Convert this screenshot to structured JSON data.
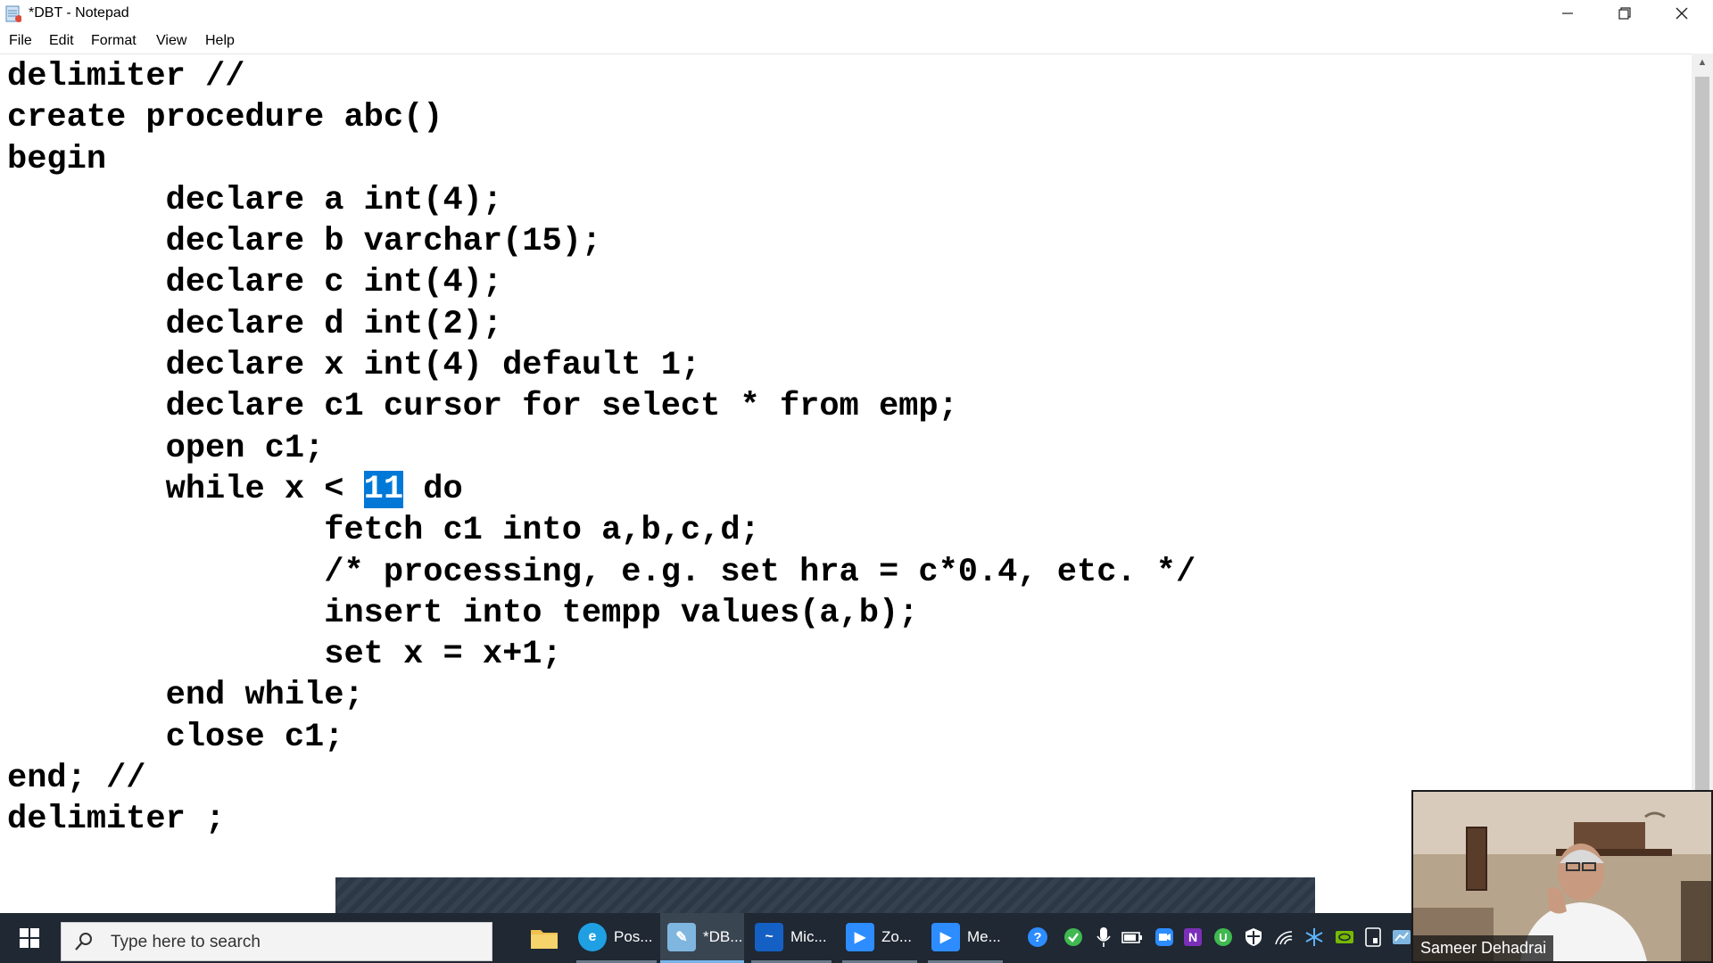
{
  "window": {
    "title": "*DBT - Notepad"
  },
  "menu": [
    "File",
    "Edit",
    "Format",
    "View",
    "Help"
  ],
  "editor": {
    "lines": [
      "delimiter //",
      "create procedure abc()",
      "begin",
      "        declare a int(4);",
      "        declare b varchar(15);",
      "        declare c int(4);",
      "        declare d int(2);",
      "        declare x int(4) default 1;",
      "        declare c1 cursor for select * from emp;",
      "        open c1;",
      "        while x < ",
      "                fetch c1 into a,b,c,d;",
      "                /* processing, e.g. set hra = c*0.4, etc. */",
      "                insert into tempp values(a,b);",
      "                set x = x+1;",
      "        end while;",
      "        close c1;",
      "end; //",
      "delimiter ;"
    ],
    "selected_text": "11",
    "after_selection": " do"
  },
  "taskbar": {
    "search_placeholder": "Type here to search",
    "apps": [
      {
        "label": "Pos...",
        "icon": "edge-icon",
        "color": "#1fa0e3",
        "state": "open"
      },
      {
        "label": "*DB...",
        "icon": "notepad-icon",
        "color": "#7fb6e0",
        "state": "active"
      },
      {
        "label": "Mic...",
        "icon": "whiteboard-icon",
        "color": "#1560c4",
        "state": "open"
      },
      {
        "label": "Zo...",
        "icon": "zoom-icon",
        "color": "#2d8cff",
        "state": "open"
      },
      {
        "label": "Me...",
        "icon": "zoom-meeting-icon",
        "color": "#2d8cff",
        "state": "open"
      }
    ]
  },
  "video": {
    "participant_name": "Sameer Dehadrai"
  },
  "colors": {
    "selection": "#0078d7",
    "taskbar": "#1f2833"
  }
}
